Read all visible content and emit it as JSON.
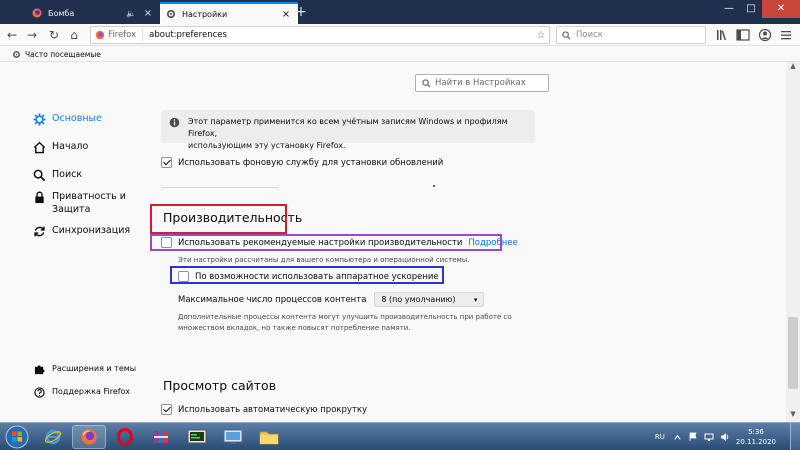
{
  "tabs": [
    {
      "title": "Бомба",
      "audio_icon": "speaker-icon",
      "close_label": "×",
      "active": false
    },
    {
      "title": "Настройки",
      "close_label": "×",
      "active": true
    }
  ],
  "new_tab_label": "+",
  "window_controls": {
    "minimize": "—",
    "maximize": "□",
    "close": "✕"
  },
  "navbar": {
    "back": "←",
    "forward": "→",
    "reload": "↻",
    "home": "⌂",
    "identity_label": "Firefox",
    "url": "about:preferences",
    "bookmark_star": "☆",
    "search_placeholder": "Поиск"
  },
  "bookmarks_bar": {
    "item": "Часто посещаемые"
  },
  "sidebar": {
    "items": [
      {
        "label": "Основные",
        "icon": "gear-icon",
        "selected": true
      },
      {
        "label": "Начало",
        "icon": "home-icon"
      },
      {
        "label": "Поиск",
        "icon": "search-icon"
      },
      {
        "label": "Приватность и Защита",
        "icon": "lock-icon"
      },
      {
        "label": "Синхронизация",
        "icon": "sync-icon"
      }
    ],
    "footer": [
      {
        "label": "Расширения и темы",
        "icon": "puzzle-icon"
      },
      {
        "label": "Поддержка Firefox",
        "icon": "help-icon"
      }
    ]
  },
  "find_placeholder": "Найти в Настройках",
  "updates": {
    "info_text_1": "Этот параметр применится ко всем учётным записям Windows и профилям Firefox,",
    "info_text_2": "использующим эту установку Firefox.",
    "background_service_label": "Использовать фоновую службу для установки обновлений",
    "background_service_checked": true
  },
  "performance": {
    "title": "Производительность",
    "recommended_label": "Использовать рекомендуемые настройки производительности",
    "recommended_checked": false,
    "learn_more": "Подробнее",
    "recommended_desc": "Эти настройки рассчитаны для вашего компьютера и операционной системы.",
    "hw_accel_label": "По возможности использовать аппаратное ускорение",
    "hw_accel_checked": false,
    "process_limit_label": "Максимальное число процессов контента",
    "process_limit_value": "8 (по умолчанию)",
    "process_desc_1": "Дополнительные процессы контента могут улучшить производительность при работе со",
    "process_desc_2": "множеством вкладок, но также повысят потребление памяти."
  },
  "browsing": {
    "title": "Просмотр сайтов",
    "autoscroll_label": "Использовать автоматическую прокрутку",
    "autoscroll_checked": true
  },
  "annotation_colors": {
    "red": "#d21f2d",
    "purple": "#9b49c8",
    "blue": "#2e36c4"
  },
  "taskbar": {
    "apps": [
      "ie-icon",
      "firefox-icon",
      "opera-icon",
      "archive-icon",
      "terminal-icon",
      "monitor-icon",
      "folder-icon"
    ],
    "language": "RU",
    "time": "5:36",
    "date": "20.11.2020"
  }
}
